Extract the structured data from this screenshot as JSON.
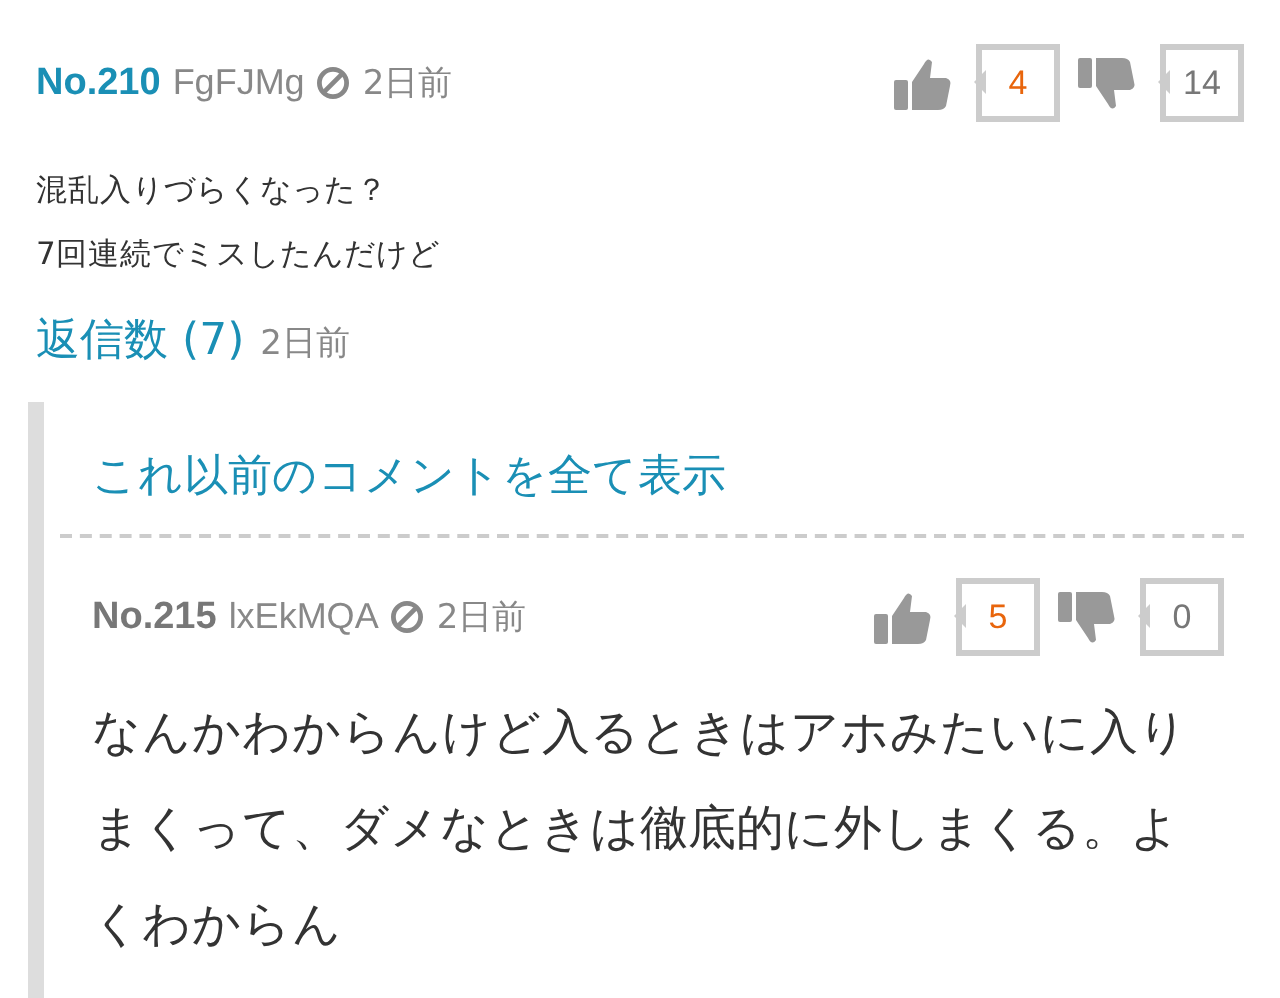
{
  "comment": {
    "number": "No.210",
    "user": "FgFJMg",
    "time": "2日前",
    "votes": {
      "up": "4",
      "down": "14"
    },
    "body": [
      "混乱入りづらくなった？",
      "7回連続でミスしたんだけど"
    ]
  },
  "replies_header": {
    "label": "返信数 (7)",
    "time": "2日前"
  },
  "show_all_link": "これ以前のコメントを全て表示",
  "replies": [
    {
      "number": "No.215",
      "user": "lxEkMQA",
      "time": "2日前",
      "votes": {
        "up": "5",
        "down": "0"
      },
      "body": "なんかわからんけど入るときはアホみたいに入りまくって、ダメなときは徹底的に外しまくる。よくわからん"
    }
  ]
}
